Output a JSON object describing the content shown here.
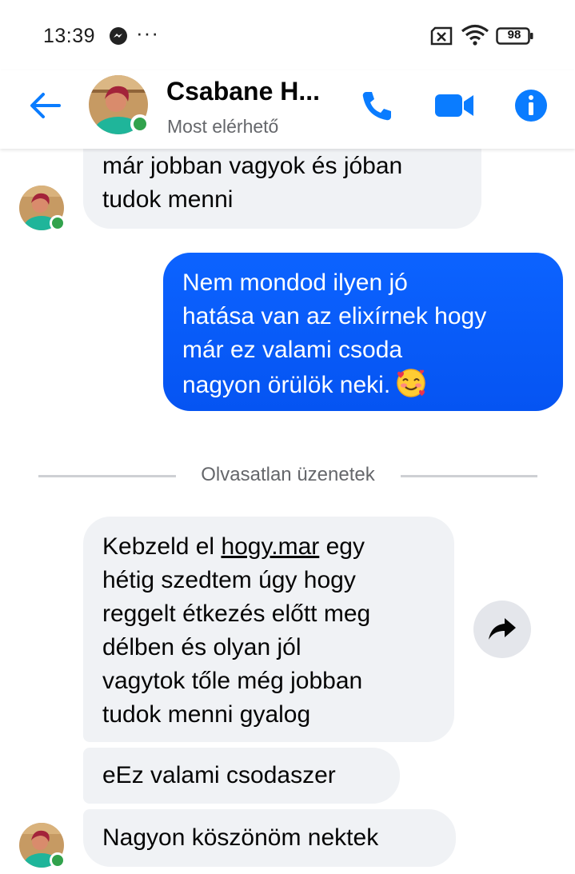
{
  "status_bar": {
    "time": "13:39",
    "dots": "···",
    "battery": "98",
    "icons": [
      "messenger-icon",
      "sim-icon",
      "wifi-icon",
      "battery-icon"
    ]
  },
  "header": {
    "contact_name": "Csabane H...",
    "contact_status": "Most elérhető",
    "icons": [
      "back-arrow-icon",
      "phone-icon",
      "video-camera-icon",
      "info-icon"
    ],
    "accent_color": "#0a7cff"
  },
  "messages": [
    {
      "direction": "incoming",
      "lines": [
        "már jobban vagyok és jóban",
        "tudok menni"
      ]
    },
    {
      "direction": "outgoing",
      "lines": [
        "Nem mondod ilyen jó",
        "hatása van az elixírnek hogy",
        "már ez valami csoda",
        "nagyon örülök neki."
      ],
      "emoji": "smiling-face-with-hearts"
    },
    {
      "direction": "incoming",
      "line1_pre": "Kebzeld el ",
      "line1_link": "hogy.mar",
      "line1_post": " egy",
      "lines": [
        "hétig szedtem úgy hogy",
        "reggelt étkezés előtt meg",
        "délben és olyan jól",
        "vagytok tőle még jobban",
        "tudok menni gyalog"
      ]
    },
    {
      "direction": "incoming",
      "lines": [
        "eEz valami csodaszer"
      ]
    },
    {
      "direction": "incoming",
      "lines": [
        "Nagyon köszönöm nektek"
      ]
    }
  ],
  "divider": {
    "label": "Olvasatlan üzenetek"
  },
  "colors": {
    "outgoing_bubble": "#0a5bff",
    "incoming_bubble": "#f0f2f5",
    "online_dot": "#31a24c"
  }
}
